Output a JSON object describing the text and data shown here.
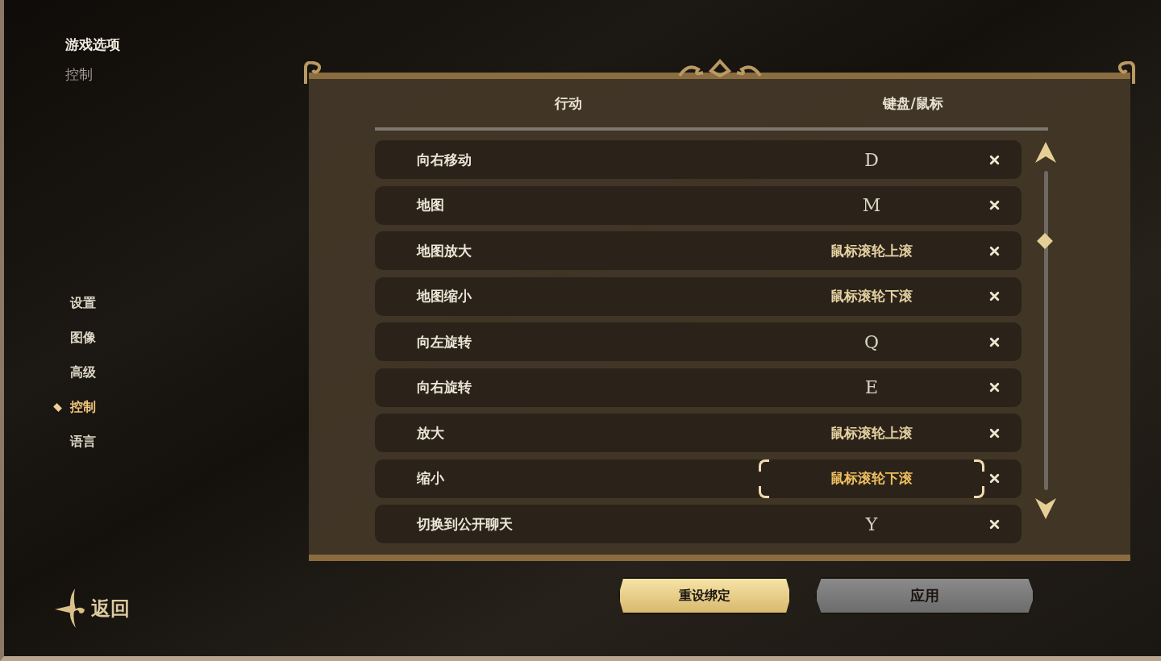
{
  "breadcrumb": {
    "title": "游戏选项",
    "subtitle": "控制"
  },
  "nav": [
    {
      "label": "设置",
      "selected": false
    },
    {
      "label": "图像",
      "selected": false
    },
    {
      "label": "高级",
      "selected": false
    },
    {
      "label": "控制",
      "selected": true
    },
    {
      "label": "语言",
      "selected": false
    }
  ],
  "back": {
    "label": "返回"
  },
  "table": {
    "columns": [
      "行动",
      "键盘/鼠标"
    ],
    "rows": [
      {
        "action": "向右移动",
        "binding": "D",
        "kind": "key",
        "selected": false
      },
      {
        "action": "地图",
        "binding": "M",
        "kind": "key",
        "selected": false
      },
      {
        "action": "地图放大",
        "binding": "鼠标滚轮上滚",
        "kind": "mouse",
        "selected": false
      },
      {
        "action": "地图缩小",
        "binding": "鼠标滚轮下滚",
        "kind": "mouse",
        "selected": false
      },
      {
        "action": "向左旋转",
        "binding": "Q",
        "kind": "key",
        "selected": false
      },
      {
        "action": "向右旋转",
        "binding": "E",
        "kind": "key",
        "selected": false
      },
      {
        "action": "放大",
        "binding": "鼠标滚轮上滚",
        "kind": "mouse",
        "selected": false
      },
      {
        "action": "缩小",
        "binding": "鼠标滚轮下滚",
        "kind": "mouse",
        "selected": true
      },
      {
        "action": "切换到公开聊天",
        "binding": "Y",
        "kind": "key",
        "selected": false
      }
    ]
  },
  "buttons": [
    {
      "label": "重设绑定",
      "kind": "primary"
    },
    {
      "label": "应用",
      "kind": "secondary"
    }
  ]
}
